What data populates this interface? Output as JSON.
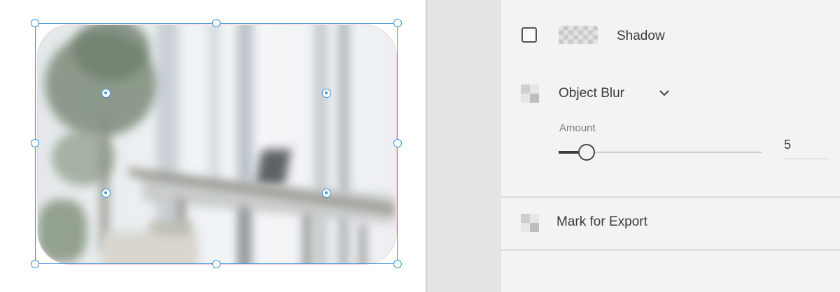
{
  "canvas": {
    "image_description_icon": "blurred-office-photo"
  },
  "inspector": {
    "shadow": {
      "label": "Shadow",
      "checked": false
    },
    "blur": {
      "effect": "Object Blur",
      "amount_label": "Amount",
      "amount_value": "5",
      "amount_fraction": 0.11
    },
    "export": {
      "label": "Mark for Export"
    }
  },
  "colors": {
    "selection": "#3a93d9",
    "inspector_bg": "#f3f3f3",
    "pasteboard_bg": "#e4e4e4"
  }
}
